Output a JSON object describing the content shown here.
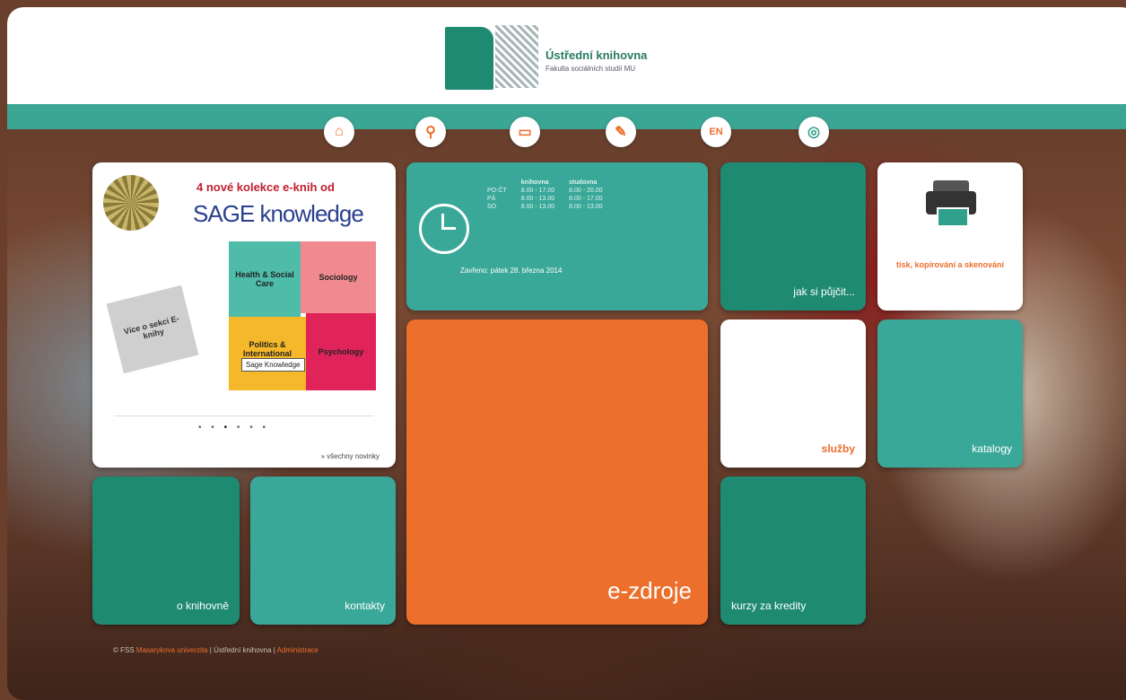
{
  "header": {
    "logo_title": "Ústřední knihovna",
    "logo_subtitle": "Fakulta sociálních studií MU"
  },
  "nav": [
    {
      "icon": "home-icon",
      "glyph": "⌂"
    },
    {
      "icon": "search-icon",
      "glyph": "⚲"
    },
    {
      "icon": "card-icon",
      "glyph": "▭"
    },
    {
      "icon": "paperclip-icon",
      "glyph": "✎"
    },
    {
      "icon": "language-icon",
      "glyph": "EN"
    },
    {
      "icon": "mu-icon",
      "glyph": "◎"
    }
  ],
  "slideshow": {
    "title": "4 nové kolekce e-knih od",
    "brand": "SAGE knowledge",
    "cells": [
      "Health & Social Care",
      "Sociology",
      "Politics & International Relations",
      "Psychology"
    ],
    "tag": "Sage Knowledge",
    "note": "Více o sekci E-knihy",
    "dots": [
      "•",
      "•",
      "•",
      "•",
      "•",
      "•"
    ],
    "active_dot": 3,
    "link": "» všechny novinky"
  },
  "hours": {
    "col1": "",
    "col2": "knihovna",
    "col3": "studovna",
    "rows": [
      [
        "PO-ČT",
        "8.00 - 17.00",
        "8.00 - 20.00"
      ],
      [
        "PÁ",
        "8.00 - 13.00",
        "8.00 - 17.00"
      ],
      [
        "SO",
        "8.00 - 13.00",
        "8.00 - 13.00"
      ]
    ],
    "note": "Zavřeno: pátek 28. března 2014"
  },
  "tiles": {
    "jak_si_pujcit": "jak si půjčit...",
    "tisk": "tisk, kopírování a skenování",
    "e_zdroje": "e-zdroje",
    "sluzby": "služby",
    "katalogy": "katalogy",
    "o_knihovne": "o knihovně",
    "kontakty": "kontakty",
    "kurzy": "kurzy za kredity"
  },
  "footer": {
    "copyright": "© FSS",
    "link1": "Masarykova univerzita",
    "sep1": "|",
    "mid": "Ústřední knihovna",
    "sep2": "|",
    "link2": "Administrace"
  },
  "colors": {
    "teal": "#1f8a72",
    "teal_light": "#3aa898",
    "orange": "#ec6f2c",
    "navbar": "#3aa693"
  }
}
